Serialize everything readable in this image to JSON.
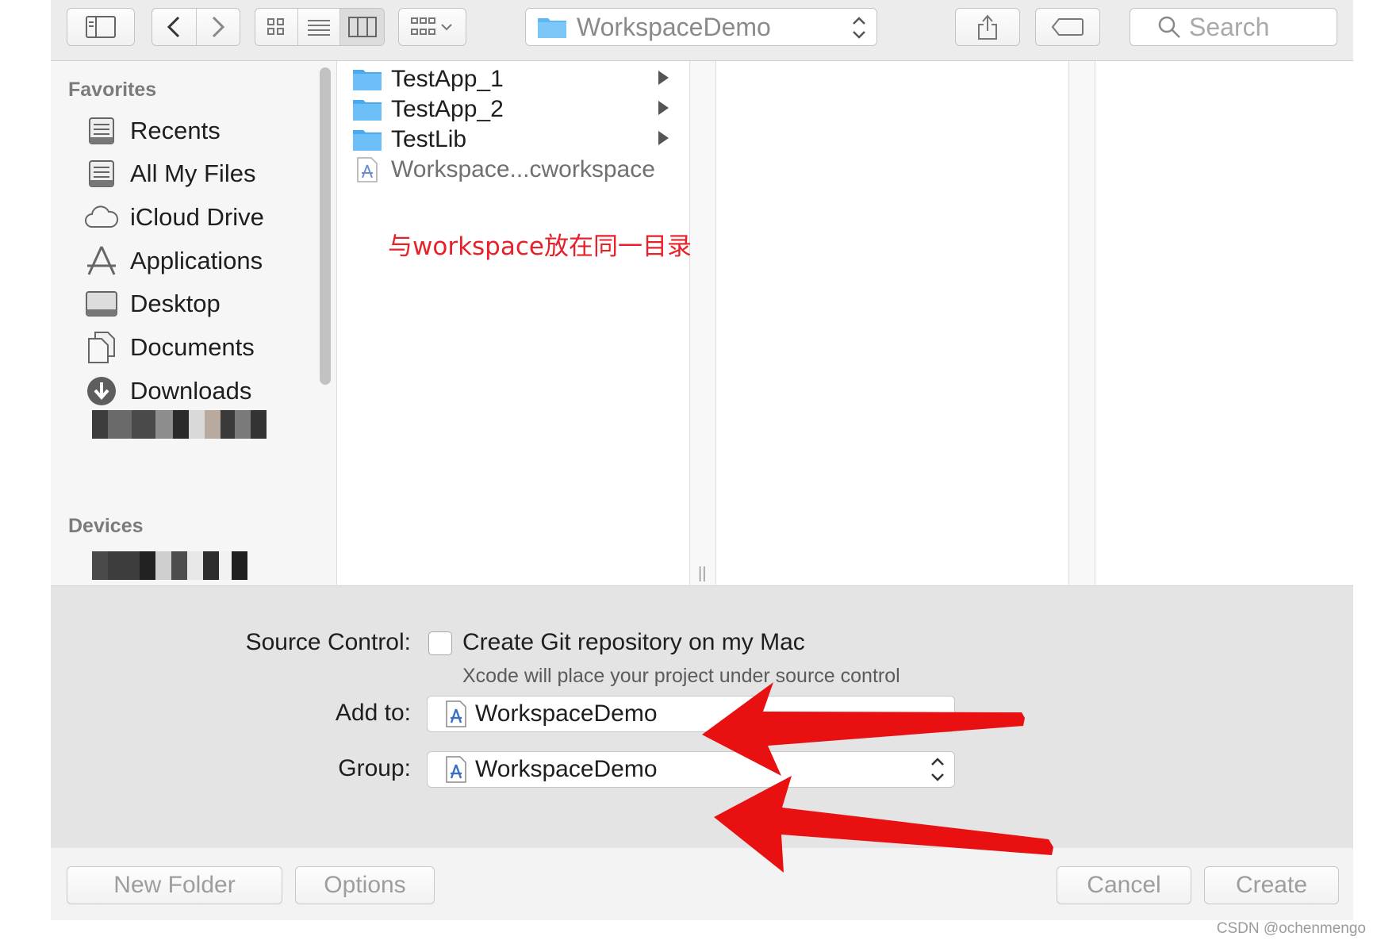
{
  "toolbar": {
    "path_label": "WorkspaceDemo",
    "search_placeholder": "Search"
  },
  "sidebar": {
    "favorites_heading": "Favorites",
    "items": [
      {
        "label": "Recents",
        "icon": "recents-icon"
      },
      {
        "label": "All My Files",
        "icon": "all-files-icon"
      },
      {
        "label": "iCloud Drive",
        "icon": "cloud-icon"
      },
      {
        "label": "Applications",
        "icon": "applications-icon"
      },
      {
        "label": "Desktop",
        "icon": "desktop-icon"
      },
      {
        "label": "Documents",
        "icon": "documents-icon"
      },
      {
        "label": "Downloads",
        "icon": "downloads-icon"
      }
    ],
    "devices_heading": "Devices"
  },
  "browser": {
    "files": [
      {
        "name": "TestApp_1",
        "kind": "folder"
      },
      {
        "name": "TestApp_2",
        "kind": "folder"
      },
      {
        "name": "TestLib",
        "kind": "folder"
      },
      {
        "name": "Workspace...cworkspace",
        "kind": "workspace"
      }
    ],
    "annotation": "与workspace放在同一目录下"
  },
  "options": {
    "source_control_label": "Source Control:",
    "git_checkbox_label": "Create Git repository on my Mac",
    "git_hint": "Xcode will place your project under source control",
    "add_to_label": "Add to:",
    "add_to_value": "WorkspaceDemo",
    "group_label": "Group:",
    "group_value": "WorkspaceDemo"
  },
  "buttons": {
    "new_folder": "New Folder",
    "options": "Options",
    "cancel": "Cancel",
    "create": "Create"
  },
  "watermark": "CSDN @ochenmengo",
  "colors": {
    "annotation_red": "#e8202a",
    "arrow_red": "#e81010",
    "folder_blue": "#5fb6f5"
  }
}
